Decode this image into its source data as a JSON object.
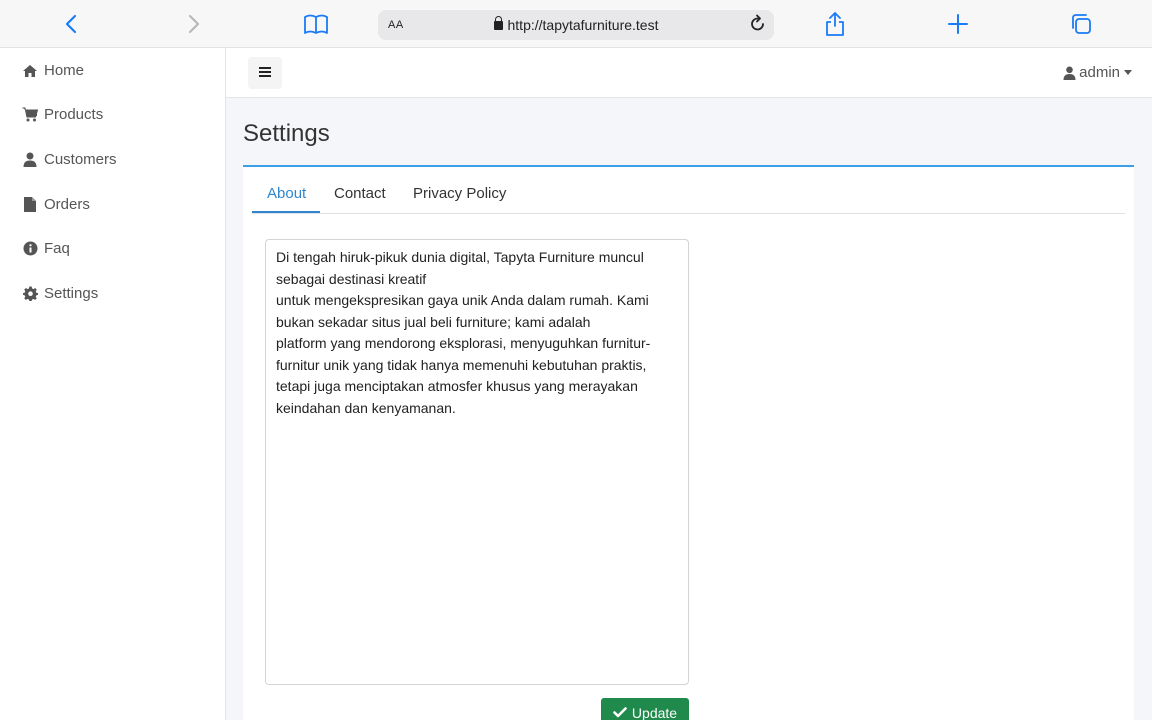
{
  "browser": {
    "text_size_label": "AA",
    "url": "http://tapytafurniture.test"
  },
  "sidebar": {
    "items": [
      {
        "label": "Home",
        "icon": "home-icon"
      },
      {
        "label": "Products",
        "icon": "cart-icon"
      },
      {
        "label": "Customers",
        "icon": "user-icon"
      },
      {
        "label": "Orders",
        "icon": "file-icon"
      },
      {
        "label": "Faq",
        "icon": "info-icon"
      },
      {
        "label": "Settings",
        "icon": "gear-icon"
      }
    ]
  },
  "header": {
    "user": "admin"
  },
  "page": {
    "title": "Settings",
    "tabs": [
      "About",
      "Contact",
      "Privacy Policy"
    ],
    "active_tab": "About",
    "about_text": "Di tengah hiruk-pikuk dunia digital, Tapyta Furniture muncul sebagai destinasi kreatif\nuntuk mengekspresikan gaya unik Anda dalam rumah. Kami bukan sekadar situs jual beli furniture; kami adalah\nplatform yang mendorong eksplorasi, menyuguhkan furnitur-furnitur unik yang tidak hanya memenuhi kebutuhan praktis, tetapi juga menciptakan atmosfer khusus yang merayakan keindahan dan kenyamanan.",
    "update_label": "Update"
  },
  "colors": {
    "accent": "#2f86cf",
    "success": "#1f8a4c",
    "ios_blue": "#1a7cf5"
  }
}
